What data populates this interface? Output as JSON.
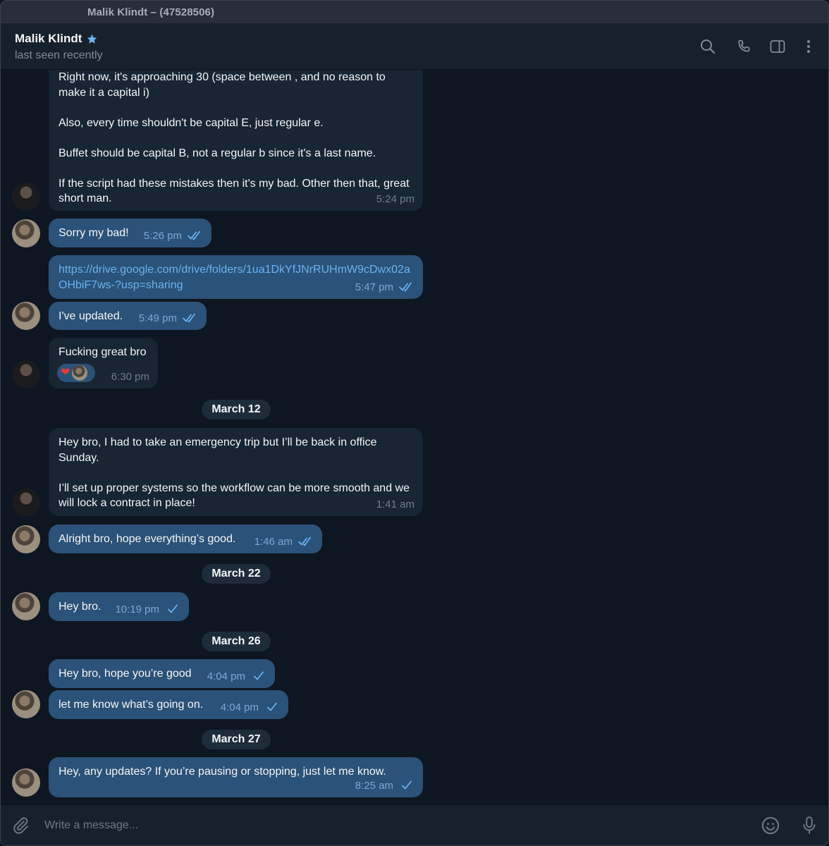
{
  "window": {
    "title": "Malik Klindt – (47528506)"
  },
  "header": {
    "name": "Malik Klindt",
    "status": "last seen recently",
    "icons": [
      "search-icon",
      "phone-icon",
      "sidebar-icon",
      "more-icon"
    ]
  },
  "messages": [
    {
      "dir": "in",
      "text": "Right now, it's approaching 30 (space between , and no reason to make it a capital i)\n\nAlso, every time shouldn't be capital E, just regular e.\n\nBuffet should be capital B, not a regular b since it's a last name.\n\nIf the script had these mistakes then it's my bad. Other then that, great short man.",
      "time": "5:24 pm"
    },
    {
      "dir": "out",
      "text": "Sorry my bad!",
      "time": "5:26 pm",
      "status": "read"
    },
    {
      "dir": "out",
      "link": "https://drive.google.com/drive/folders/1ua1DkYfJNrRUHmW9cDwx02aOHbiF7ws-?usp=sharing",
      "time": "5:47 pm",
      "status": "read"
    },
    {
      "dir": "out",
      "text": "I've updated.",
      "time": "5:49 pm",
      "status": "read"
    },
    {
      "dir": "in",
      "text": "Fucking great bro",
      "time": "6:30 pm",
      "reaction": "heart"
    },
    {
      "date": "March 12"
    },
    {
      "dir": "in",
      "text": "Hey bro, I had to take an emergency trip but I’ll be back in office Sunday.\n\nI’ll set up proper systems so the workflow can be more smooth and we will lock a contract in place!",
      "time": "1:41 am"
    },
    {
      "dir": "out",
      "text": "Alright bro, hope everything’s good.",
      "time": "1:46 am",
      "status": "read"
    },
    {
      "date": "March 22"
    },
    {
      "dir": "out",
      "text": "Hey bro.",
      "time": "10:19 pm",
      "status": "sent"
    },
    {
      "date": "March 26"
    },
    {
      "dir": "out",
      "text": "Hey bro, hope you’re good",
      "time": "4:04 pm",
      "status": "sent"
    },
    {
      "dir": "out",
      "text": "let me know what’s going on.",
      "time": "4:04 pm",
      "status": "sent"
    },
    {
      "date": "March 27"
    },
    {
      "dir": "out",
      "text": "Hey, any updates? If you’re pausing or stopping, just let me know.",
      "time": "8:25 am",
      "status": "sent"
    }
  ],
  "composer": {
    "placeholder": "Write a message...",
    "icons": [
      "attach-icon",
      "emoji-icon",
      "microphone-icon"
    ]
  },
  "colors": {
    "background": "#0e1621",
    "incoming_bubble": "#182533",
    "outgoing_bubble": "#2b5278",
    "accent": "#6ab2f2"
  }
}
